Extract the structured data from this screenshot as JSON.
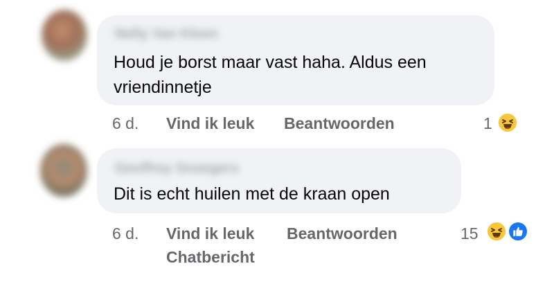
{
  "colors": {
    "bubble_background": "#f0f2f5",
    "comment_text": "#050505",
    "meta_text": "#65676b",
    "haha_reaction": "#f7c63b",
    "like_reaction": "#1877f2"
  },
  "comments": [
    {
      "author": "Nelly Van Kleen",
      "text": "Houd je borst maar vast haha. Aldus een\nvriendinnetje",
      "timestamp": "6 d.",
      "like_label": "Vind ik leuk",
      "reply_label": "Beantwoorden",
      "reaction_count": "1",
      "reactions": [
        "haha-icon"
      ]
    },
    {
      "author": "Geoffrey Snoegers",
      "text": "Dit is echt huilen met de kraan open",
      "timestamp": "6 d.",
      "like_label": "Vind ik leuk",
      "reply_label": "Beantwoorden",
      "message_label": "Chatbericht",
      "reaction_count": "15",
      "reactions": [
        "haha-icon",
        "like-icon"
      ]
    }
  ]
}
